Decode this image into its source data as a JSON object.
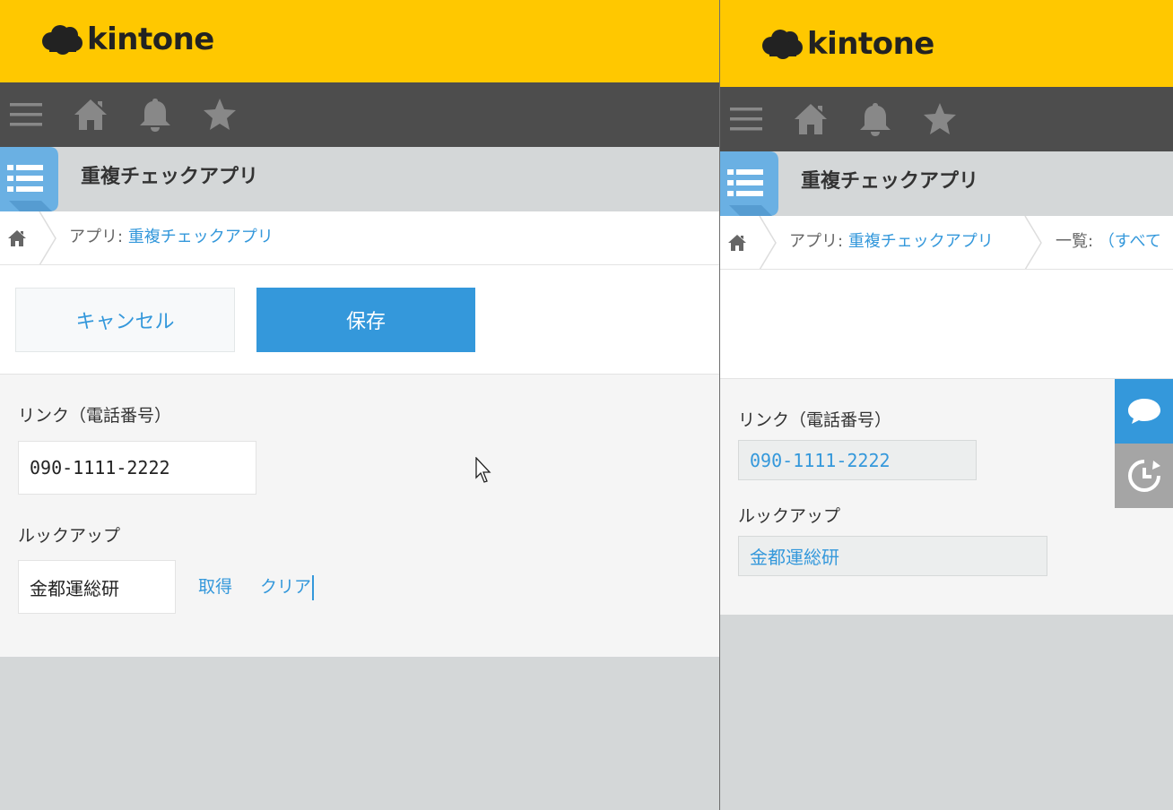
{
  "brand": {
    "name": "kintone",
    "color": "#ffc800",
    "accent": "#3498db"
  },
  "nav": {
    "icons": [
      "menu-icon",
      "home-icon",
      "notification-bell-icon",
      "favorite-star-icon"
    ]
  },
  "app": {
    "title": "重複チェックアプリ"
  },
  "breadcrumb": {
    "app_prefix": "アプリ:",
    "app_link": "重複チェックアプリ",
    "view_prefix": "一覧:",
    "view_link": "（すべて"
  },
  "toolbar": {
    "cancel_label": "キャンセル",
    "save_label": "保存"
  },
  "form": {
    "phone_label": "リンク（電話番号）",
    "phone_value": "090-1111-2222",
    "lookup_label": "ルックアップ",
    "lookup_value": "金都運総研",
    "lookup_get": "取得",
    "lookup_clear": "クリア"
  },
  "sidebar_right": {
    "icons": [
      "comment-icon",
      "history-icon"
    ]
  }
}
